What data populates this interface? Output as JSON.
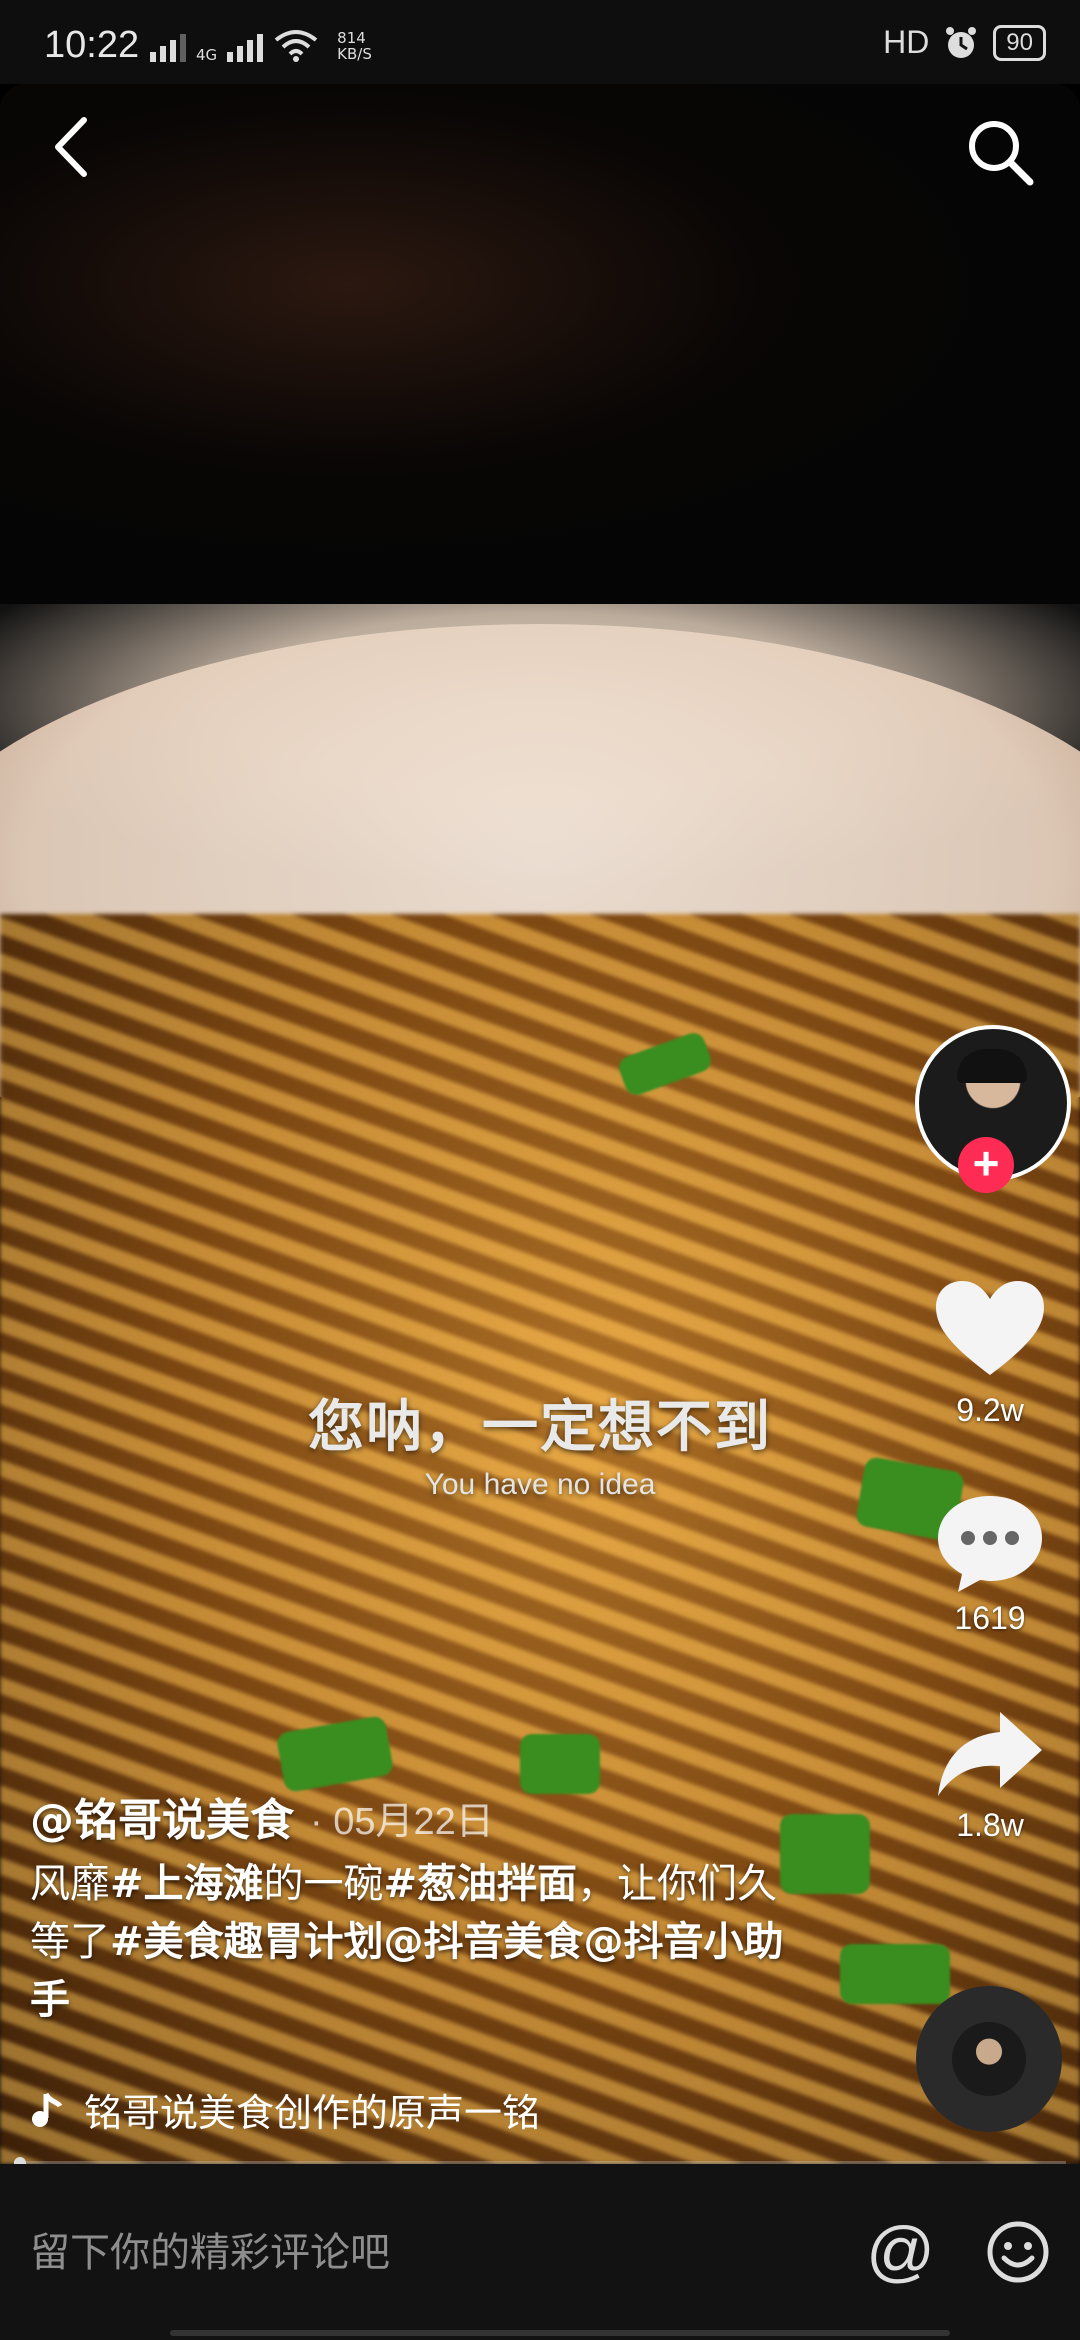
{
  "status_bar": {
    "time": "10:22",
    "network": "4G",
    "speed_value": "814",
    "speed_unit": "KB/S",
    "hd": "HD",
    "battery": "90"
  },
  "video": {
    "subtitle_cn": "您呐，一定想不到",
    "subtitle_en": "You have no idea"
  },
  "rail": {
    "follow_symbol": "+",
    "likes": "9.2w",
    "comments": "1619",
    "shares": "1.8w"
  },
  "caption": {
    "author": "@铭哥说美食",
    "date": "· 05月22日",
    "desc_parts": [
      "风靡",
      "#上海滩",
      "的一碗",
      "#葱油拌面",
      "，让你们久等了",
      "#美食趣胃计划",
      "@抖音美食",
      "@抖音小助手"
    ]
  },
  "music": {
    "text": "铭哥说美食创作的原声一铭"
  },
  "progress": {
    "fraction": 0.01
  },
  "comment_bar": {
    "placeholder": "留下你的精彩评论吧",
    "at_symbol": "@"
  }
}
